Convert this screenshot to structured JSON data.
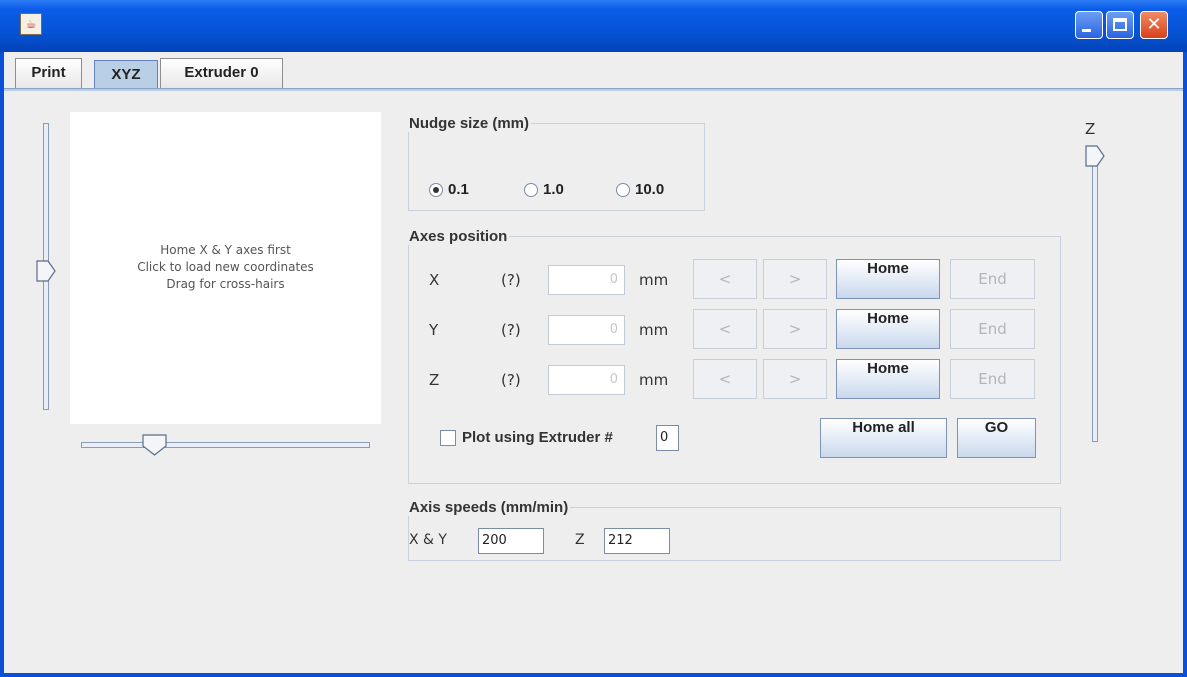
{
  "window": {
    "title": ""
  },
  "tabs": [
    {
      "label": "Print",
      "selected": false
    },
    {
      "label": "XYZ",
      "selected": true
    },
    {
      "label": "Extruder 0",
      "selected": false
    }
  ],
  "plot": {
    "messages": [
      "Home X & Y axes first",
      "Click to load new coordinates",
      "Drag for cross-hairs"
    ]
  },
  "nudge": {
    "title": "Nudge size (mm)",
    "options": [
      {
        "label": "0.1",
        "selected": true
      },
      {
        "label": "1.0",
        "selected": false
      },
      {
        "label": "10.0",
        "selected": false
      }
    ]
  },
  "axes": {
    "title": "Axes position",
    "rows": [
      {
        "axis": "X",
        "status": "(?)",
        "value": "0",
        "unit": "mm",
        "dec": "<",
        "inc": ">",
        "home": "Home",
        "end": "End"
      },
      {
        "axis": "Y",
        "status": "(?)",
        "value": "0",
        "unit": "mm",
        "dec": "<",
        "inc": ">",
        "home": "Home",
        "end": "End"
      },
      {
        "axis": "Z",
        "status": "(?)",
        "value": "0",
        "unit": "mm",
        "dec": "<",
        "inc": ">",
        "home": "Home",
        "end": "End"
      }
    ],
    "plot_extruder_label": "Plot using Extruder #",
    "plot_extruder_value": "0",
    "plot_extruder_checked": false,
    "home_all": "Home all",
    "go": "GO"
  },
  "speeds": {
    "title": "Axis speeds (mm/min)",
    "xy_label": "X & Y",
    "xy_value": "200",
    "z_label": "Z",
    "z_value": "212"
  },
  "z_slider": {
    "label": "Z"
  },
  "colors": {
    "titlebar": "#0654d6",
    "tab_selected": "#b8cfe5",
    "panel": "#eeeeee"
  }
}
